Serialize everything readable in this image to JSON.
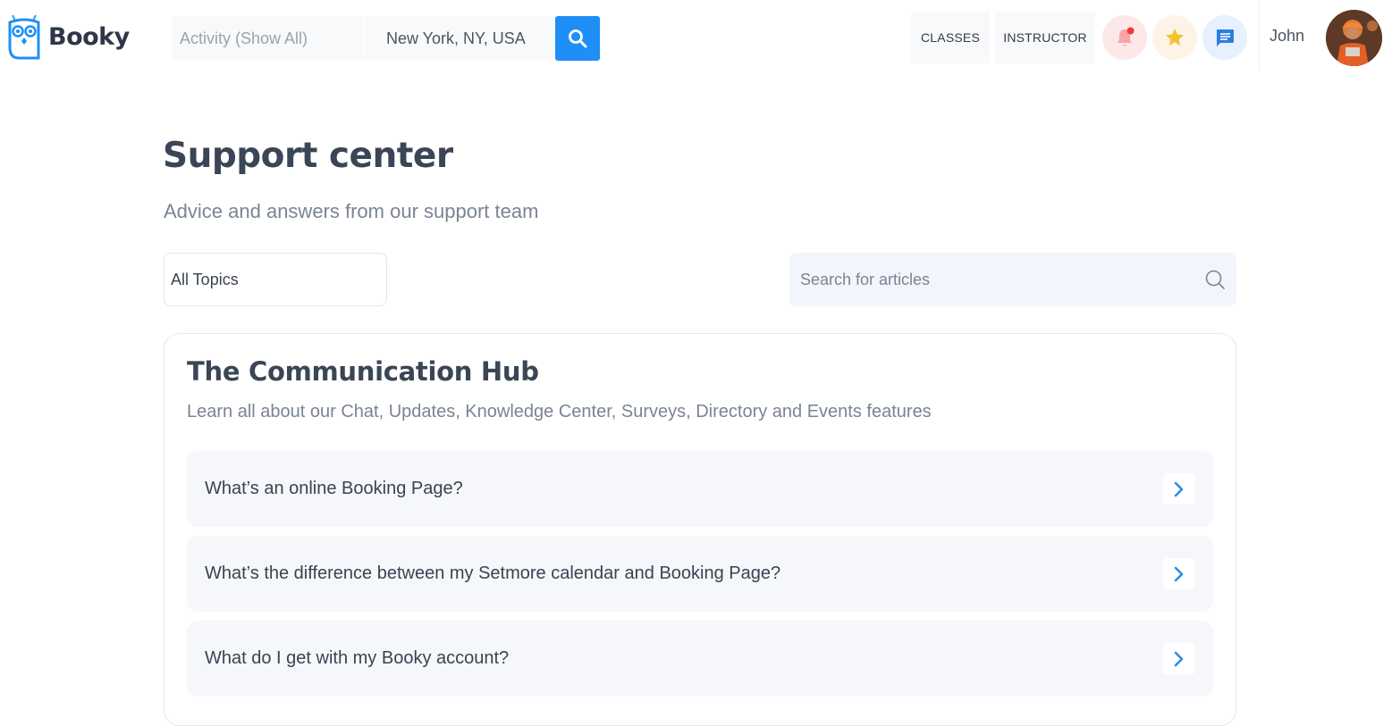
{
  "brand": {
    "name": "Booky",
    "accent": "#1e8ff7"
  },
  "header": {
    "activity_placeholder": "Activity (Show All)",
    "location_value": "New York, NY, USA",
    "nav": {
      "classes": "CLASSES",
      "instructor": "INSTRUCTOR"
    },
    "icons": {
      "notifications": "bell-icon",
      "favorites": "star-icon",
      "messages": "chat-icon"
    },
    "user": {
      "name": "John"
    }
  },
  "main": {
    "title": "Support center",
    "subtitle": "Advice and answers from our support team",
    "topics_select": {
      "selected": "All Topics"
    },
    "article_search": {
      "placeholder": "Search for articles"
    },
    "section": {
      "title": "The Communication Hub",
      "description": "Learn all about our Chat, Updates, Knowledge Center, Surveys, Directory and Events features",
      "faqs": [
        {
          "question": "What’s an online Booking Page?"
        },
        {
          "question": "What’s the difference between my Setmore calendar and Booking Page?"
        },
        {
          "question": "What do I get with my Booky account?"
        }
      ]
    }
  }
}
